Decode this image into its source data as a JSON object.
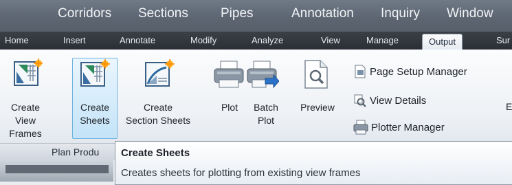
{
  "menubar": {
    "items": [
      "Corridors",
      "Sections",
      "Pipes",
      "Annotation",
      "Inquiry",
      "Window"
    ]
  },
  "ribbon_tabs": [
    "Home",
    "Insert",
    "Annotate",
    "Modify",
    "Analyze",
    "View",
    "Manage",
    "Output",
    "Sur"
  ],
  "active_tab": "Output",
  "buttons": {
    "create_view_frames": [
      "Create View",
      "Frames"
    ],
    "create_sheets": [
      "Create",
      "Sheets"
    ],
    "create_section_sheets": [
      "Create",
      "Section Sheets"
    ],
    "plot": "Plot",
    "batch_plot": [
      "Batch",
      "Plot"
    ],
    "preview": "Preview",
    "page_setup_manager": "Page Setup Manager",
    "view_details": "View Details",
    "plotter_manager": "Plotter Manager",
    "cut_off": "E"
  },
  "panel_label": "Plan Produ",
  "tooltip": {
    "title": "Create Sheets",
    "description": "Creates sheets for plotting from existing view frames"
  },
  "colors": {
    "menubar": "#5d6672",
    "tabbar": "#2b2f35",
    "ribbon": "#eef1f5",
    "selected_highlight": "#c4e3f8",
    "selected_border": "#6fb3e0"
  }
}
